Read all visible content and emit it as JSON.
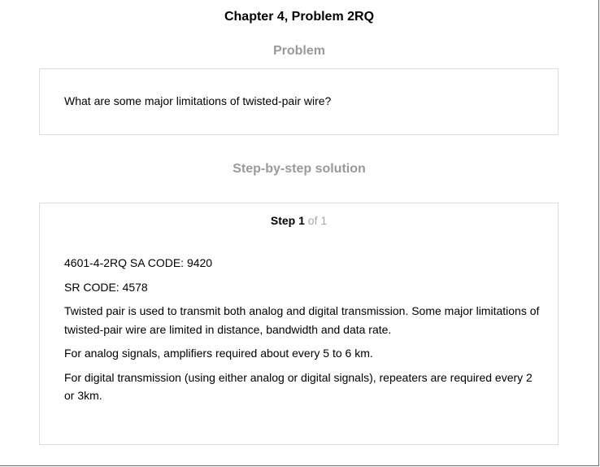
{
  "header": {
    "chapter_title": "Chapter 4, Problem 2RQ"
  },
  "problem": {
    "heading": "Problem",
    "text": "What are some major limitations of twisted-pair wire?"
  },
  "solution": {
    "heading": "Step-by-step solution",
    "step": {
      "label": "Step",
      "number": "1",
      "of_text": "of 1"
    },
    "paragraphs": [
      "4601-4-2RQ SA CODE: 9420",
      "SR CODE: 4578",
      "Twisted pair is used to transmit both analog and digital transmission. Some major limitations of twisted-pair wire are limited in distance, bandwidth and data rate.",
      "For analog signals, amplifiers required about every 5 to 6 km.",
      "For digital transmission (using either analog or digital signals), repeaters are required every 2 or 3km."
    ]
  }
}
